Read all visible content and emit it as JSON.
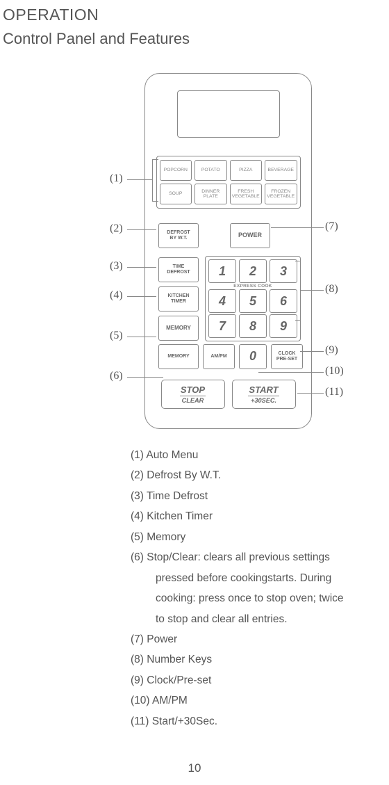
{
  "heading1": "OPERATION",
  "heading2": "Control Panel and Features",
  "pageNumber": "10",
  "annotations": {
    "a1": "(1)",
    "a2": "(2)",
    "a3": "(3)",
    "a4": "(4)",
    "a5": "(5)",
    "a6": "(6)",
    "a7": "(7)",
    "a8": "(8)",
    "a9": "(9)",
    "a10": "(10)",
    "a11": "(11)"
  },
  "panel": {
    "auto": {
      "r1": {
        "b1": "POPCORN",
        "b2": "POTATO",
        "b3": "PIZZA",
        "b4": "BEVERAGE"
      },
      "r2": {
        "b1": "SOUP",
        "b2": "DINNER\nPLATE",
        "b3": "FRESH\nVEGETABLE",
        "b4": "FROZEN\nVEGETABLE"
      }
    },
    "defrostWT": "DEFROST\nBY W.T.",
    "power": "POWER",
    "timeDefrost": "TIME\nDEFROST",
    "kitchenTimer": "KITCHEN\nTIMER",
    "memory": "MEMORY",
    "ampm": "AM/PM",
    "clockPreset": "CLOCK\nPRE-SET",
    "expressCook": "EXPRESS COOK",
    "keys": {
      "k0": "0",
      "k1": "1",
      "k2": "2",
      "k3": "3",
      "k4": "4",
      "k5": "5",
      "k6": "6",
      "k7": "7",
      "k8": "8",
      "k9": "9"
    },
    "stop": {
      "top": "STOP",
      "sub": "CLEAR"
    },
    "start": {
      "top": "START",
      "sub": "+30SEC."
    }
  },
  "legend": {
    "l1": "(1)   Auto Menu",
    "l2": "(2)   Defrost By W.T.",
    "l3": "(3) Time Defrost",
    "l4": "(4)  Kitchen Timer",
    "l5": "(5)  Memory",
    "l6a": "(6) Stop/Clear: clears all previous settings",
    "l6b": "pressed before cookingstarts. During",
    "l6c": "cooking: press once to stop oven; twice",
    "l6d": "to stop and clear all entries.",
    "l7": "(7) Power",
    "l8": "(8) Number Keys",
    "l9": "(9)  Clock/Pre-set",
    "l10": "(10)  AM/PM",
    "l11": "(11) Start/+30Sec."
  }
}
